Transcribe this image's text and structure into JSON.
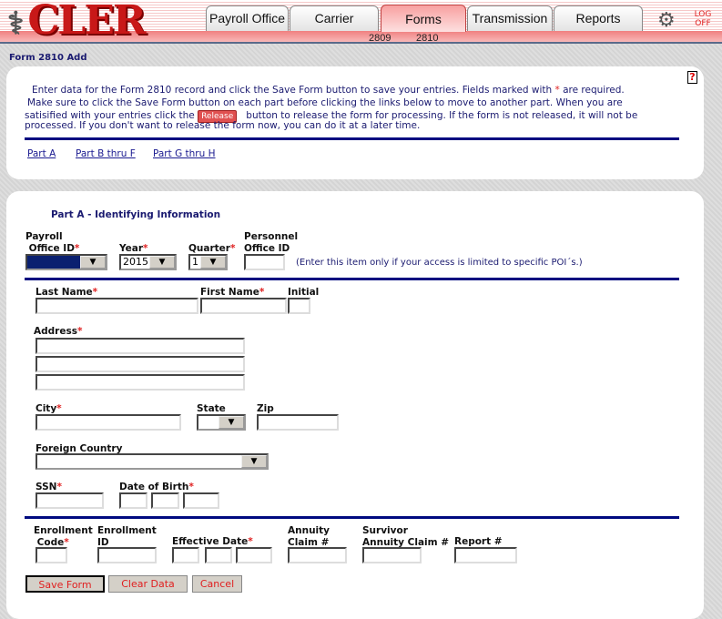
{
  "header": {
    "logo_text": "CLER",
    "tabs": [
      {
        "label": "Payroll Office"
      },
      {
        "label": "Carrier"
      },
      {
        "label": "Forms",
        "active": true
      },
      {
        "label": "Transmission"
      },
      {
        "label": "Reports"
      }
    ],
    "sub_items": [
      "2809",
      "2810"
    ],
    "logoff": "LOG OFF",
    "colors": {
      "accent": "#e02020",
      "nav": "#000a80"
    }
  },
  "page_title": "Form 2810 Add",
  "intro": {
    "line1a": "Enter data for the Form 2810 record and click the Save Form button to save your entries.  Fields marked with ",
    "star": "*",
    "line1b": " are required.",
    "line2": "Make sure to click the Save Form button on each part before clicking the links below to move to another part.  When you are",
    "line3a": "satisified with your entries click the ",
    "release": "Release",
    "line3b": " button to release the form for processing.  If the form is not released, it will not be",
    "line4": "processed.  If you don't want to release the form now, you can do it at a later time."
  },
  "links": [
    "Part A",
    "Part B thru F",
    "Part G thru H"
  ],
  "section_title": "Part A - Identifying Information",
  "fields": {
    "payroll1": "Payroll",
    "payroll2": "Office ID",
    "year": "Year",
    "year_value": "2015",
    "quarter": "Quarter",
    "quarter_value": "1",
    "poi1": "Personnel",
    "poi2": "Office ID",
    "poi_note": "(Enter this item only if your access is limited to specific POI´s.)",
    "last": "Last Name",
    "first": "First Name",
    "initial": "Initial",
    "address": "Address",
    "city": "City",
    "state": "State",
    "zip": "Zip",
    "foreign": "Foreign Country",
    "ssn": "SSN",
    "dob": "Date of Birth",
    "enr_code1": "Enrollment",
    "enr_code2": "Code",
    "enr_id1": "Enrollment",
    "enr_id2": "ID",
    "eff": "Effective Date",
    "ann1": "Annuity",
    "ann2": "Claim #",
    "surv1": "Survivor",
    "surv2": "Annuity Claim #",
    "report": "Report #",
    "star": "*"
  },
  "buttons": {
    "save": "Save Form",
    "clear": "Clear Data",
    "cancel": "Cancel"
  }
}
